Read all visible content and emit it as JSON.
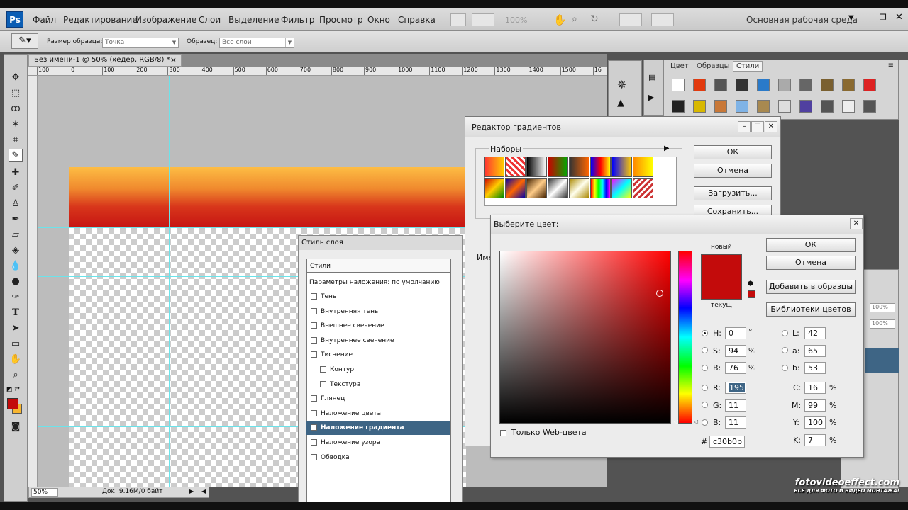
{
  "menubar": {
    "logo": "Ps",
    "items": [
      "Файл",
      "Редактирование",
      "Изображение",
      "Слои",
      "Выделение",
      "Фильтр",
      "Просмотр",
      "Окно",
      "Справка"
    ],
    "zoom": "100%",
    "workspace": "Основная рабочая среда"
  },
  "options": {
    "sample_size_label": "Размер образца:",
    "sample_size_value": "Точка",
    "sample_label": "Образец:",
    "sample_value": "Все слои"
  },
  "document": {
    "tab_title": "Без имени-1 @ 50% (хедер, RGB/8) *",
    "ruler_ticks": [
      "100",
      "0",
      "100",
      "200",
      "300",
      "400",
      "500",
      "600",
      "700",
      "800",
      "900",
      "1000",
      "1100",
      "1200",
      "1300",
      "1400",
      "1500",
      "16"
    ],
    "zoom": "50%",
    "doc_info": "Док: 9.16M/0 байт"
  },
  "swatches_panel": {
    "tabs": [
      "Цвет",
      "Образцы",
      "Стили"
    ]
  },
  "right_lower": {
    "opacity_1": "100%",
    "opacity_2": "100%"
  },
  "gradient_editor": {
    "title": "Редактор градиентов",
    "presets_label": "Наборы",
    "ok": "ОК",
    "cancel": "Отмена",
    "load": "Загрузить...",
    "save": "Сохранить...",
    "name_partial": "Имя"
  },
  "layer_style": {
    "title": "Стиль слоя",
    "styles_header": "Стили",
    "blending": "Параметры наложения: по умолчанию",
    "items": [
      {
        "label": "Тень",
        "checked": false,
        "indent": false,
        "active": false
      },
      {
        "label": "Внутренняя тень",
        "checked": false,
        "indent": false,
        "active": false
      },
      {
        "label": "Внешнее свечение",
        "checked": false,
        "indent": false,
        "active": false
      },
      {
        "label": "Внутреннее свечение",
        "checked": false,
        "indent": false,
        "active": false
      },
      {
        "label": "Тиснение",
        "checked": false,
        "indent": false,
        "active": false
      },
      {
        "label": "Контур",
        "checked": false,
        "indent": true,
        "active": false
      },
      {
        "label": "Текстура",
        "checked": false,
        "indent": true,
        "active": false
      },
      {
        "label": "Глянец",
        "checked": false,
        "indent": false,
        "active": false
      },
      {
        "label": "Наложение цвета",
        "checked": false,
        "indent": false,
        "active": false
      },
      {
        "label": "Наложение градиента",
        "checked": true,
        "indent": false,
        "active": true
      },
      {
        "label": "Наложение узора",
        "checked": false,
        "indent": false,
        "active": false
      },
      {
        "label": "Обводка",
        "checked": false,
        "indent": false,
        "active": false
      }
    ]
  },
  "color_picker": {
    "title": "Выберите цвет:",
    "new_label": "новый",
    "current_label": "текущ",
    "new_color": "#c30b0b",
    "ok": "ОК",
    "cancel": "Отмена",
    "add_swatch": "Добавить в образцы",
    "libraries": "Библиотеки цветов",
    "web_only": "Только Web-цвета",
    "h_label": "H:",
    "h": "0",
    "h_unit": "°",
    "s_label": "S:",
    "s": "94",
    "s_unit": "%",
    "b_label": "B:",
    "b": "76",
    "b_unit": "%",
    "r_label": "R:",
    "r": "195",
    "g_label": "G:",
    "g": "11",
    "bb_label": "B:",
    "bb": "11",
    "l_label": "L:",
    "l": "42",
    "a_label": "a:",
    "a": "65",
    "lb_label": "b:",
    "lb": "53",
    "c_label": "C:",
    "c": "16",
    "c_unit": "%",
    "m_label": "M:",
    "m": "99",
    "m_unit": "%",
    "y_label": "Y:",
    "y": "100",
    "y_unit": "%",
    "k_label": "K:",
    "k": "7",
    "k_unit": "%",
    "hex_label": "#",
    "hex": "c30b0b"
  },
  "watermark": {
    "brand": "fotovideoeffect.com",
    "tagline": "ВСЕ ДЛЯ ФОТО И ВИДЕО МОНТАЖА!"
  }
}
